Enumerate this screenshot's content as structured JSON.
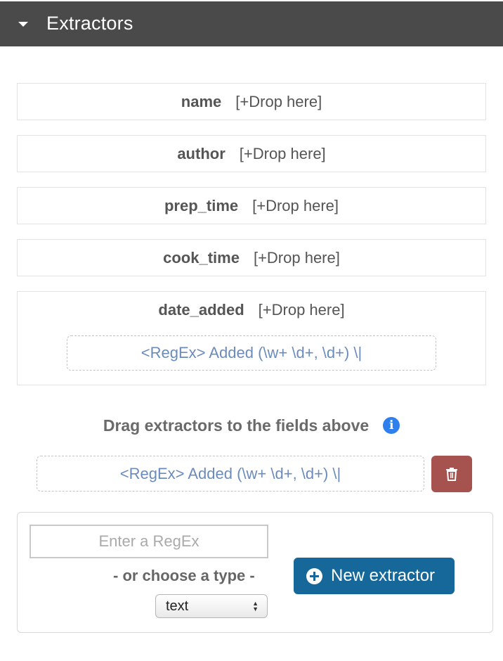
{
  "header": {
    "title": "Extractors"
  },
  "fields": [
    {
      "name": "name",
      "drop": "[+Drop here]"
    },
    {
      "name": "author",
      "drop": "[+Drop here]"
    },
    {
      "name": "prep_time",
      "drop": "[+Drop here]"
    },
    {
      "name": "cook_time",
      "drop": "[+Drop here]"
    },
    {
      "name": "date_added",
      "drop": "[+Drop here]",
      "extractor": "<RegEx> Added (\\w+ \\d+, \\d+) \\|"
    }
  ],
  "drag_hint": {
    "text": "Drag extractors to the fields above"
  },
  "available_extractor": {
    "label": "<RegEx> Added (\\w+ \\d+, \\d+) \\|"
  },
  "new_extractor": {
    "regex_placeholder": "Enter a RegEx",
    "choose_label": "- or choose a type -",
    "type_selected": "text",
    "button_label": "New extractor"
  },
  "colors": {
    "header_bg": "#4a4a4a",
    "extractor_text": "#6b8bbd",
    "delete_button": "#a65350",
    "primary_button": "#16689b",
    "info_icon": "#2f80ed"
  }
}
